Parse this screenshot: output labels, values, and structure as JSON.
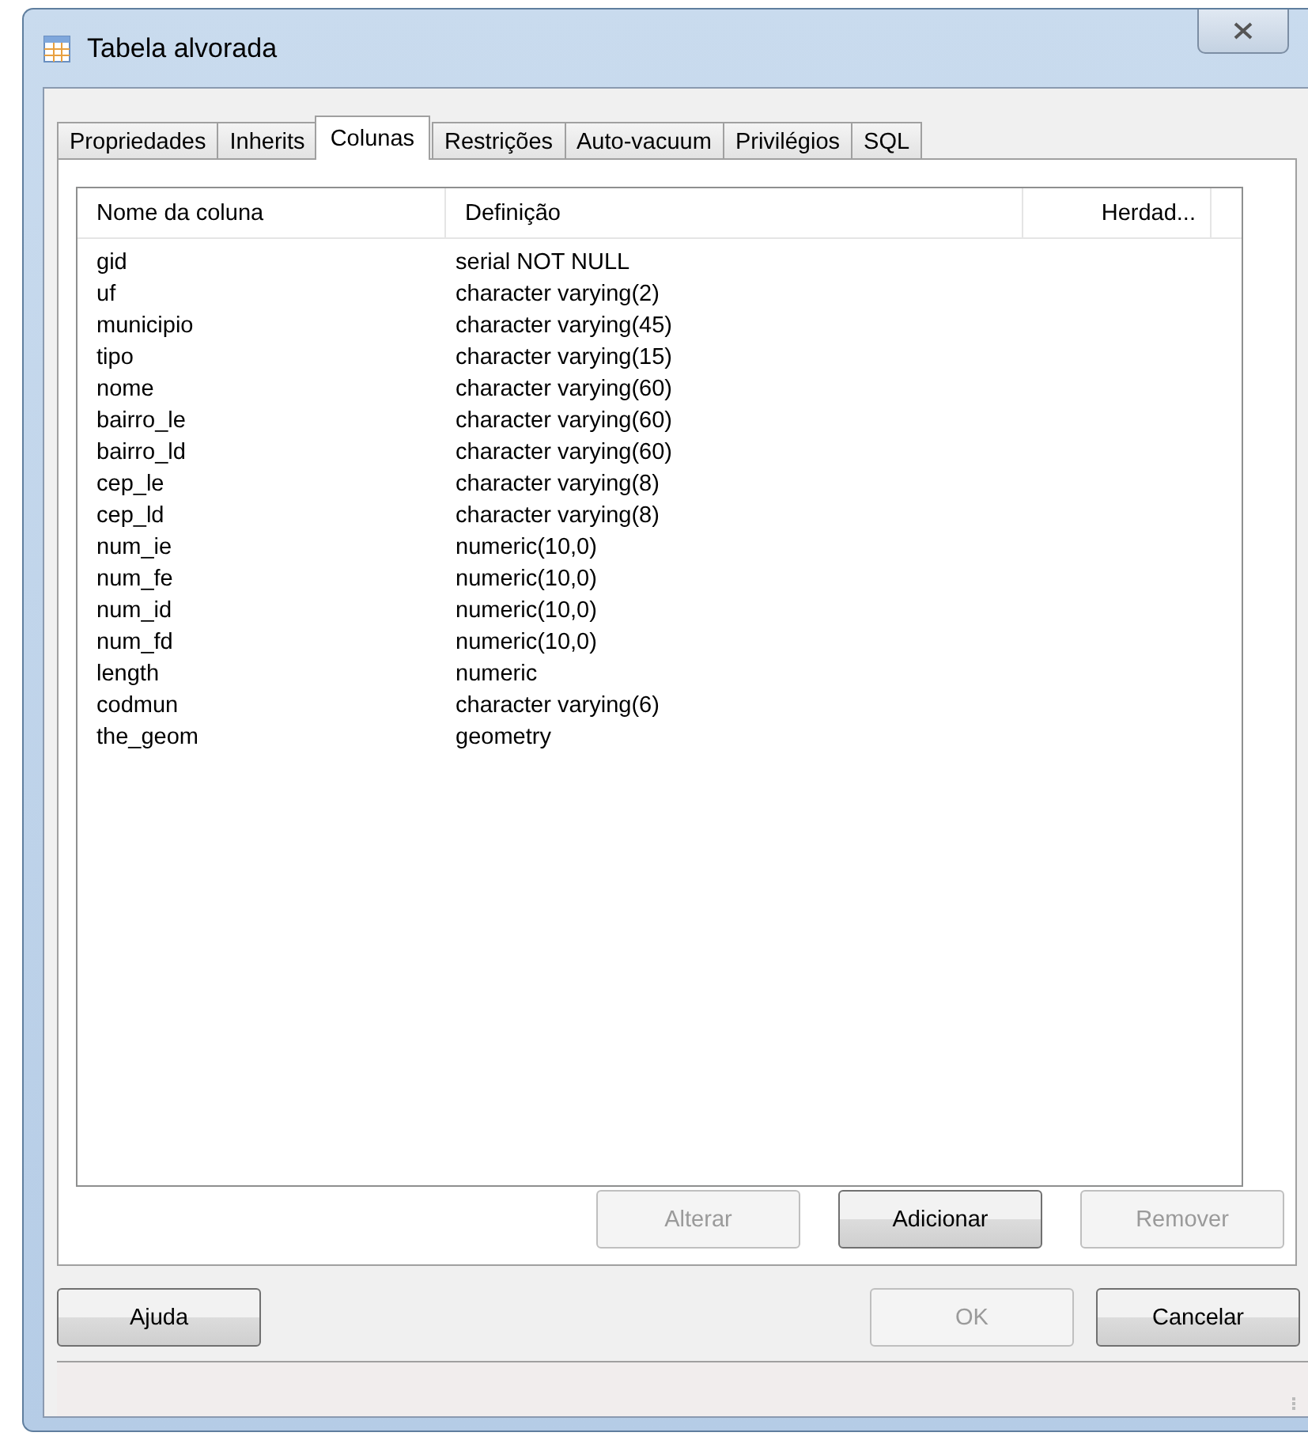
{
  "window": {
    "title": "Tabela alvorada"
  },
  "tabs": [
    {
      "label": "Propriedades",
      "selected": false
    },
    {
      "label": "Inherits",
      "selected": false
    },
    {
      "label": "Colunas",
      "selected": true
    },
    {
      "label": "Restrições",
      "selected": false
    },
    {
      "label": "Auto-vacuum",
      "selected": false
    },
    {
      "label": "Privilégios",
      "selected": false
    },
    {
      "label": "SQL",
      "selected": false
    }
  ],
  "table": {
    "columns": [
      "Nome da coluna",
      "Definição",
      "Herdad..."
    ],
    "rows": [
      {
        "name": "gid",
        "definition": "serial NOT NULL"
      },
      {
        "name": "uf",
        "definition": "character varying(2)"
      },
      {
        "name": "municipio",
        "definition": "character varying(45)"
      },
      {
        "name": "tipo",
        "definition": "character varying(15)"
      },
      {
        "name": "nome",
        "definition": "character varying(60)"
      },
      {
        "name": "bairro_le",
        "definition": "character varying(60)"
      },
      {
        "name": "bairro_ld",
        "definition": "character varying(60)"
      },
      {
        "name": "cep_le",
        "definition": "character varying(8)"
      },
      {
        "name": "cep_ld",
        "definition": "character varying(8)"
      },
      {
        "name": "num_ie",
        "definition": "numeric(10,0)"
      },
      {
        "name": "num_fe",
        "definition": "numeric(10,0)"
      },
      {
        "name": "num_id",
        "definition": "numeric(10,0)"
      },
      {
        "name": "num_fd",
        "definition": "numeric(10,0)"
      },
      {
        "name": "length",
        "definition": "numeric"
      },
      {
        "name": "codmun",
        "definition": "character varying(6)"
      },
      {
        "name": "the_geom",
        "definition": "geometry"
      }
    ]
  },
  "panel_buttons": [
    {
      "label": "Alterar",
      "disabled": true
    },
    {
      "label": "Adicionar",
      "disabled": false
    },
    {
      "label": "Remover",
      "disabled": true
    }
  ],
  "left_buttons": [
    {
      "label": "Ajuda",
      "disabled": false
    }
  ],
  "right_buttons": [
    {
      "label": "OK",
      "disabled": true
    },
    {
      "label": "Cancelar",
      "disabled": false
    }
  ]
}
